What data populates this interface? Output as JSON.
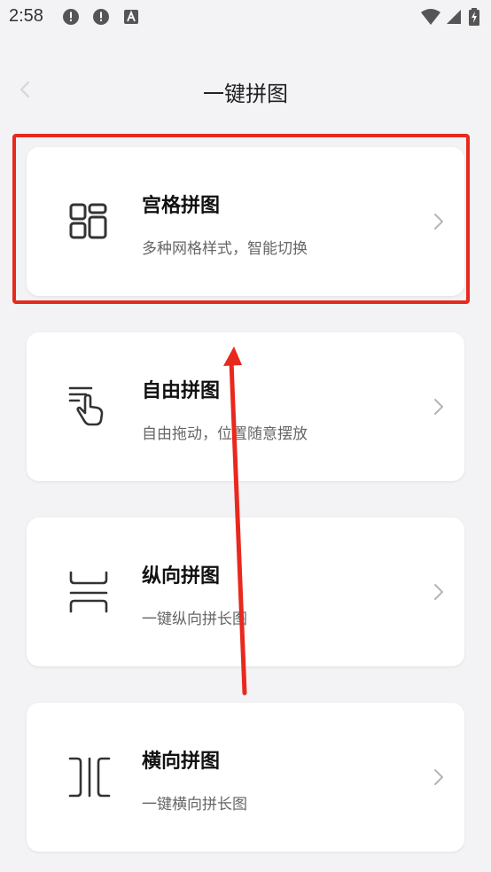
{
  "status_bar": {
    "time": "2:58",
    "icons": [
      "alert-icon",
      "alert-icon",
      "accessibility-icon",
      "wifi-icon",
      "signal-icon",
      "battery-charging-icon"
    ]
  },
  "header": {
    "title": "一键拼图",
    "back_icon": "chevron-left-icon"
  },
  "cards": [
    {
      "title": "宫格拼图",
      "subtitle": "多种网格样式，智能切换",
      "icon": "grid-icon"
    },
    {
      "title": "自由拼图",
      "subtitle": "自由拖动，位置随意摆放",
      "icon": "hand-drag-icon"
    },
    {
      "title": "纵向拼图",
      "subtitle": "一键纵向拼长图",
      "icon": "vertical-stitch-icon"
    },
    {
      "title": "横向拼图",
      "subtitle": "一键横向拼长图",
      "icon": "horizontal-stitch-icon"
    }
  ],
  "colors": {
    "background": "#f3f3f5",
    "card": "#ffffff",
    "annotation": "#e8291e"
  }
}
